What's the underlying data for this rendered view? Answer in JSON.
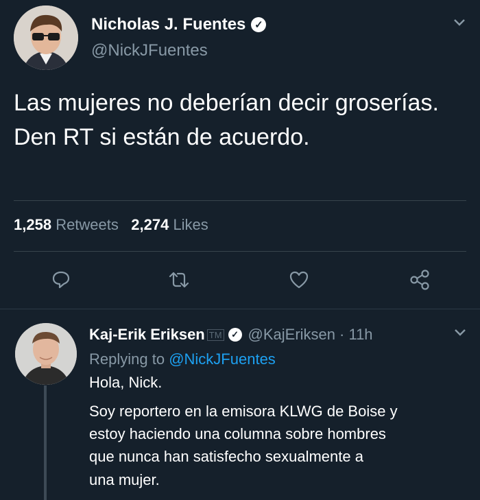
{
  "main_tweet": {
    "author_name": "Nicholas J. Fuentes",
    "author_handle": "@NickJFuentes",
    "text_line1": "Las mujeres no deberían decir groserías.",
    "text_line2": "Den RT si están de acuerdo.",
    "retweets_count": "1,258",
    "retweets_label": "Retweets",
    "likes_count": "2,274",
    "likes_label": "Likes",
    "icons": [
      "reply-icon",
      "retweet-icon",
      "like-icon",
      "share-icon",
      "chevron-down-icon",
      "verified-badge-icon"
    ]
  },
  "reply_tweet": {
    "author_name": "Kaj-Erik Eriksen",
    "name_suffix": "TM",
    "author_handle": "@KajEriksen",
    "timestamp": "· 11h",
    "replying_label": "Replying to",
    "replying_handle": "@NickJFuentes",
    "lines": [
      "Hola, Nick.",
      "Soy reportero en la emisora KLWG de Boise y",
      "estoy haciendo una columna sobre hombres",
      "que nunca han satisfecho sexualmente a",
      "una mujer."
    ]
  },
  "colors": {
    "background": "#15202b",
    "text": "#ffffff",
    "secondary": "#8899a6",
    "link": "#1da1f2",
    "divider": "#38444d"
  }
}
